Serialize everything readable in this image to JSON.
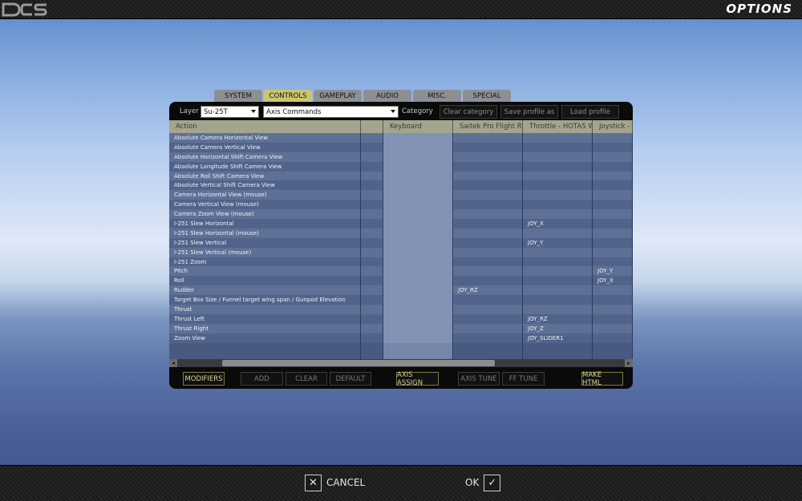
{
  "header": {
    "logo": "DCS",
    "title": "OPTIONS"
  },
  "tabs": [
    {
      "label": "SYSTEM",
      "active": false
    },
    {
      "label": "CONTROLS",
      "active": true
    },
    {
      "label": "GAMEPLAY",
      "active": false
    },
    {
      "label": "AUDIO",
      "active": false
    },
    {
      "label": "MISC.",
      "active": false
    },
    {
      "label": "SPECIAL",
      "active": false
    }
  ],
  "toolbar": {
    "layer_label": "Layer",
    "layer_value": "Su-25T",
    "category_value": "Axis Commands",
    "category_label": "Category",
    "clear_category": "Clear category",
    "save_profile": "Save profile as",
    "load_profile": "Load profile"
  },
  "columns": [
    "Action",
    "",
    "Keyboard",
    "Saitek Pro Flight Rudder",
    "Throttle - HOTAS Warthog",
    "Joystick - HOTAS Warthog"
  ],
  "rows": [
    [
      "Absolute Camera Horizontal View",
      "",
      "",
      "",
      "",
      ""
    ],
    [
      "Absolute Camera Vertical View",
      "",
      "",
      "",
      "",
      ""
    ],
    [
      "Absolute Horizontal Shift Camera View",
      "",
      "",
      "",
      "",
      ""
    ],
    [
      "Absolute Longitude Shift Camera View",
      "",
      "",
      "",
      "",
      ""
    ],
    [
      "Absolute Roll Shift Camera View",
      "",
      "",
      "",
      "",
      ""
    ],
    [
      "Absolute Vertical Shift Camera View",
      "",
      "",
      "",
      "",
      ""
    ],
    [
      "Camera Horizontal View (mouse)",
      "",
      "",
      "",
      "",
      ""
    ],
    [
      "Camera Vertical View (mouse)",
      "",
      "",
      "",
      "",
      ""
    ],
    [
      "Camera Zoom View (mouse)",
      "",
      "",
      "",
      "",
      ""
    ],
    [
      "I-251 Slew Horizontal",
      "",
      "",
      "",
      "JOY_X",
      ""
    ],
    [
      "I-251 Slew Horizontal (mouse)",
      "",
      "",
      "",
      "",
      ""
    ],
    [
      "I-251 Slew Vertical",
      "",
      "",
      "",
      "JOY_Y",
      ""
    ],
    [
      "I-251 Slew Vertical (mouse)",
      "",
      "",
      "",
      "",
      ""
    ],
    [
      "I-251 Zoom",
      "",
      "",
      "",
      "",
      ""
    ],
    [
      "Pitch",
      "",
      "",
      "",
      "",
      "JOY_Y"
    ],
    [
      "Roll",
      "",
      "",
      "",
      "",
      "JOY_X"
    ],
    [
      "Rudder",
      "",
      "",
      "JOY_RZ",
      "",
      ""
    ],
    [
      "Target Box Size / Funnel target wing span / Gunpod Elevation",
      "",
      "",
      "",
      "",
      ""
    ],
    [
      "Thrust",
      "",
      "",
      "",
      "",
      ""
    ],
    [
      "Thrust Left",
      "",
      "",
      "",
      "JOY_RZ",
      ""
    ],
    [
      "Thrust Right",
      "",
      "",
      "",
      "JOY_Z",
      ""
    ],
    [
      "Zoom View",
      "",
      "",
      "",
      "JOY_SLIDER1",
      ""
    ]
  ],
  "actions": {
    "modifiers": "MODIFIERS",
    "add": "ADD",
    "clear": "CLEAR",
    "default": "DEFAULT",
    "axis_assign": "AXIS ASSIGN",
    "axis_tune": "AXIS TUNE",
    "ff_tune": "FF TUNE",
    "make_html": "MAKE HTML"
  },
  "footer": {
    "cancel": "CANCEL",
    "ok": "OK"
  }
}
